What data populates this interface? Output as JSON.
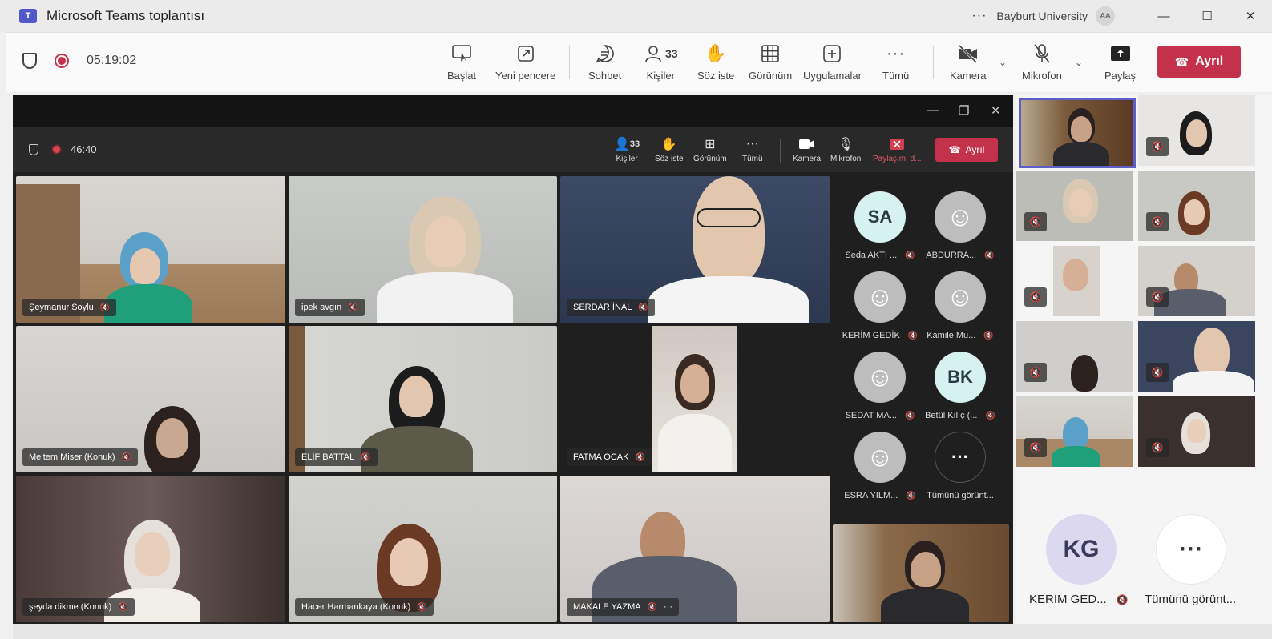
{
  "window": {
    "app_icon": "teams-icon",
    "title": "Microsoft Teams toplantısı",
    "organization": "Bayburt University",
    "account_initials": "AA",
    "minimize_icon": "—",
    "maximize_icon": "☐",
    "close_icon": "✕"
  },
  "toolbar": {
    "timer": "05:19:02",
    "buttons": {
      "start": "Başlat",
      "new_window": "Yeni pencere",
      "chat": "Sohbet",
      "people": "Kişiler",
      "people_count": "33",
      "raise_hand": "Söz iste",
      "view": "Görünüm",
      "apps": "Uygulamalar",
      "more": "Tümü",
      "camera": "Kamera",
      "mic": "Mikrofon",
      "share": "Paylaş",
      "leave": "Ayrıl"
    }
  },
  "inner_meeting": {
    "timer": "46:40",
    "buttons": {
      "people": "Kişiler",
      "people_count": "33",
      "raise_hand": "Söz iste",
      "view": "Görünüm",
      "more": "Tümü",
      "camera": "Kamera",
      "mic": "Mikrofon",
      "share": "Paylaşımı d...",
      "leave": "Ayrıl"
    },
    "tiles": [
      {
        "name": "Şeymanur Soylu"
      },
      {
        "name": "ipek avgın"
      },
      {
        "name": "SERDAR İNAL"
      },
      {
        "name": "Meltem Miser (Konuk)"
      },
      {
        "name": "ELİF BATTAL"
      },
      {
        "name": "FATMA OCAK"
      },
      {
        "name": "şeyda dikme (Konuk)"
      },
      {
        "name": "Hacer Harmankaya (Konuk)"
      },
      {
        "name": "MAKALE YAZMA"
      }
    ],
    "participants": [
      {
        "initials": "SA",
        "name": "Seda AKTI ..."
      },
      {
        "initials": "",
        "name": "ABDURRA..."
      },
      {
        "initials": "",
        "name": "KERİM GEDİK"
      },
      {
        "initials": "",
        "name": "Kamile Mu..."
      },
      {
        "initials": "",
        "name": "SEDAT MA..."
      },
      {
        "initials": "BK",
        "name": "Betül Kılıç (..."
      },
      {
        "initials": "",
        "name": "ESRA YILM..."
      },
      {
        "initials": "···",
        "name": "Tümünü görünt..."
      }
    ]
  },
  "stage": {
    "big_participants": [
      {
        "initials": "KG",
        "name": "KERİM GED..."
      },
      {
        "initials": "···",
        "name": "Tümünü görünt..."
      }
    ]
  },
  "colors": {
    "leave_red": "#c4314b",
    "teams_purple": "#5059c9",
    "active_border": "#5b5fc7"
  }
}
